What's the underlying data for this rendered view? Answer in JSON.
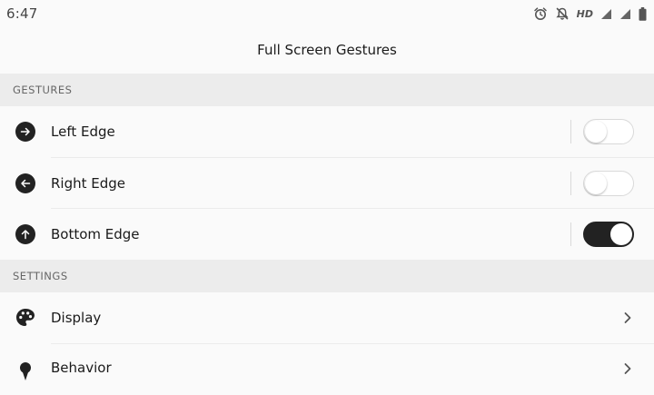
{
  "status_bar": {
    "time": "6:47",
    "hd": "HD",
    "icons": [
      "alarm-icon",
      "notifications-off-icon",
      "signal-icon",
      "signal-icon",
      "battery-icon"
    ]
  },
  "header": {
    "title": "Full Screen Gestures"
  },
  "sections": {
    "gestures": {
      "title": "GESTURES",
      "items": [
        {
          "label": "Left Edge",
          "icon": "arrow-right-icon",
          "enabled": false
        },
        {
          "label": "Right Edge",
          "icon": "arrow-left-icon",
          "enabled": false
        },
        {
          "label": "Bottom Edge",
          "icon": "arrow-up-icon",
          "enabled": true
        }
      ]
    },
    "settings": {
      "title": "SETTINGS",
      "items": [
        {
          "label": "Display",
          "icon": "palette-icon"
        },
        {
          "label": "Behavior",
          "icon": "behavior-icon"
        }
      ]
    }
  },
  "colors": {
    "accent": "#222222",
    "background": "#fafafa",
    "section_bg": "#ececec"
  }
}
